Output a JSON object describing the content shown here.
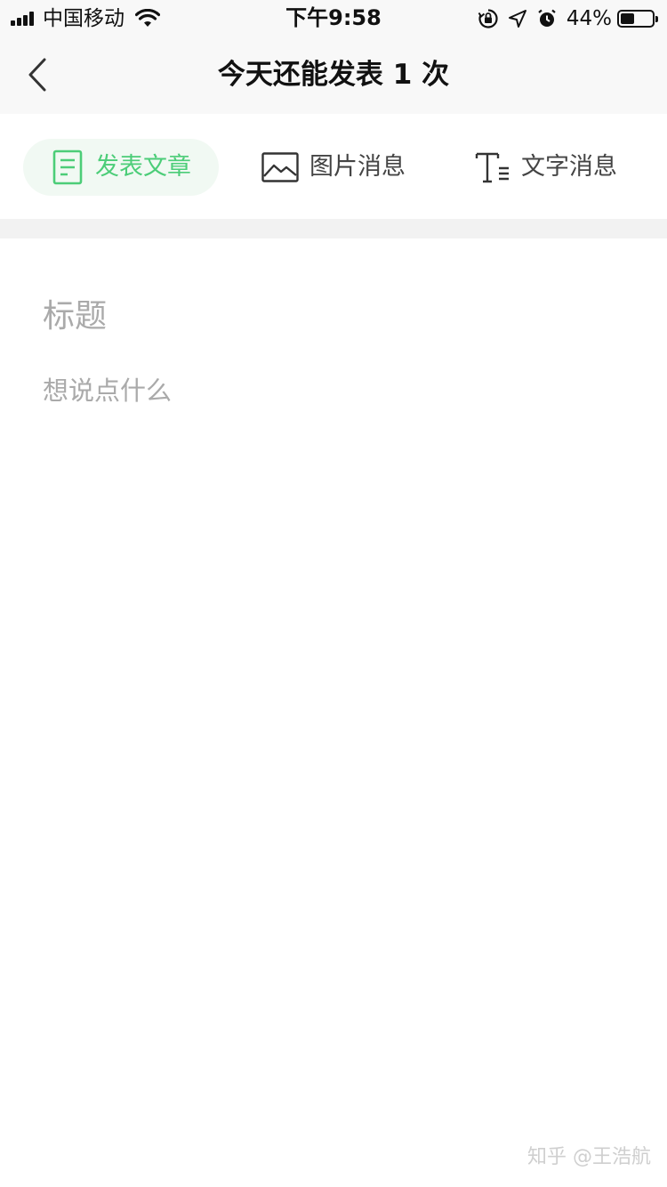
{
  "status_bar": {
    "carrier": "中国移动",
    "time": "下午9:58",
    "battery_percent": "44%",
    "battery_level": 0.44,
    "icons": [
      "signal-icon",
      "wifi-icon",
      "orientation-lock-icon",
      "location-icon",
      "alarm-icon",
      "battery-icon"
    ]
  },
  "nav": {
    "title": "今天还能发表 1 次",
    "back_icon": "chevron-left-icon"
  },
  "tabs": [
    {
      "label": "发表文章",
      "icon": "document-icon",
      "active": true
    },
    {
      "label": "图片消息",
      "icon": "image-icon",
      "active": false
    },
    {
      "label": "文字消息",
      "icon": "text-icon",
      "active": false
    }
  ],
  "editor": {
    "title_placeholder": "标题",
    "body_placeholder": "想说点什么"
  },
  "watermark": "知乎 @王浩航",
  "colors": {
    "accent": "#4ccd78",
    "active_tab_bg": "#f1f9f3",
    "placeholder": "#aaaaaa",
    "bar_bg": "#f8f8f8",
    "divider": "#f2f2f2"
  }
}
